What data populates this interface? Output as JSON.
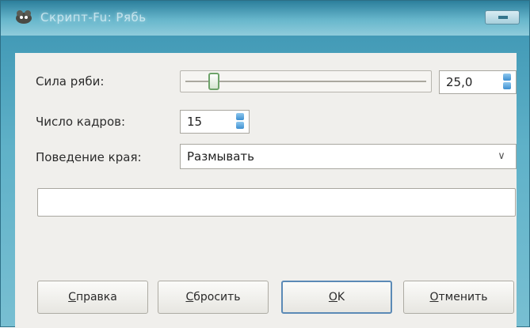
{
  "window": {
    "title": "Скрипт-Fu: Рябь"
  },
  "form": {
    "ripple_label": "Сила ряби:",
    "ripple_value": "25,0",
    "ripple_fraction": 0.1,
    "frames_label": "Число кадров:",
    "frames_value": "15",
    "edge_label": "Поведение края:",
    "edge_value": "Размывать"
  },
  "buttons": {
    "help": {
      "mnemonic": "С",
      "rest": "правка"
    },
    "reset": {
      "mnemonic": "С",
      "rest": "бросить"
    },
    "ok": {
      "mnemonic": "O",
      "rest": "K"
    },
    "cancel": {
      "mnemonic": "О",
      "rest": "тменить"
    }
  },
  "colors": {
    "title_gradient": "#3a93b1",
    "client_bg": "#f0efec",
    "spin_arrow": "#3d8fd0",
    "knob_border": "#6ea36a"
  },
  "icons": {
    "app": "gimp-icon",
    "close": "close-icon",
    "spin": "spin-arrows-icon",
    "dropdown": "chevron-down-icon"
  }
}
